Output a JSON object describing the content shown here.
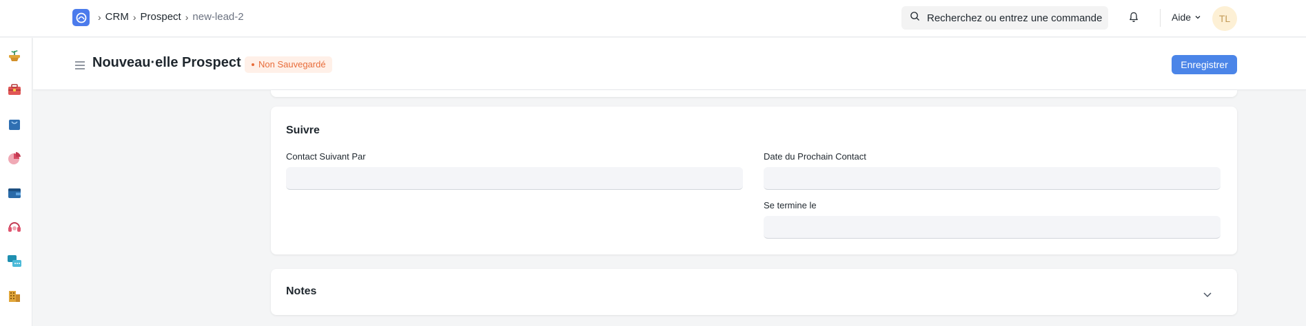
{
  "breadcrumb": {
    "crm": "CRM",
    "prospect": "Prospect",
    "current": "new-lead-2"
  },
  "search": {
    "placeholder": "Recherchez ou entrez une commande"
  },
  "help": {
    "label": "Aide"
  },
  "avatar": {
    "initials": "TL"
  },
  "page": {
    "title": "Nouveau·elle Prospect",
    "status": "Non Sauvegardé",
    "save_label": "Enregistrer"
  },
  "suivre": {
    "title": "Suivre",
    "contact_by_label": "Contact Suivant Par",
    "contact_by_value": "",
    "next_contact_date_label": "Date du Prochain Contact",
    "next_contact_date_value": "",
    "ends_on_label": "Se termine le",
    "ends_on_value": ""
  },
  "notes": {
    "title": "Notes"
  },
  "sidebar_icons": [
    "plant-icon",
    "toolbox-icon",
    "shopping-bag-icon",
    "pie-chart-icon",
    "wallet-icon",
    "headset-icon",
    "chat-icon",
    "building-icon"
  ],
  "colors": {
    "primary": "#4b85e8",
    "unsaved": "#e86c3a"
  }
}
